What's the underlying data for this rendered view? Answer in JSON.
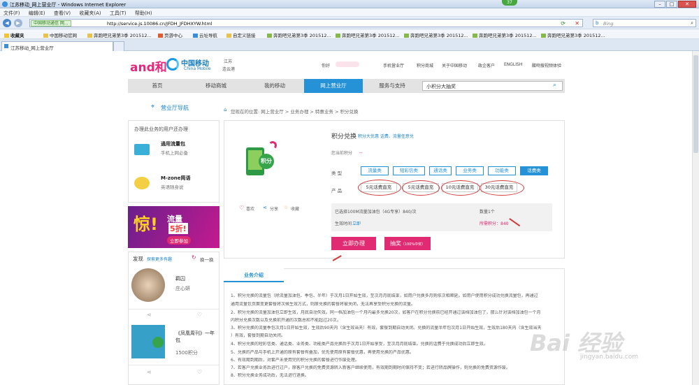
{
  "window": {
    "title": "江苏移动_网上营业厅 - Windows Internet Explorer",
    "badge": "37"
  },
  "menu": [
    "文件(F)",
    "编辑(E)",
    "查看(V)",
    "收藏夹(A)",
    "工具(T)",
    "帮助(H)"
  ],
  "address": {
    "site_label": "中国移动通信 网...",
    "url": "http://service.js.10086.cn/JFDH_JFDHXYW.html",
    "search_placeholder": "Bing"
  },
  "favorites": {
    "label": "收藏夹",
    "items": [
      "中国移动官网",
      "奔跑吧兄弟第3季 201512...",
      "页游中心",
      "云址导航",
      "自定义链接",
      "奔跑吧兄弟第3季 201512...",
      "奔跑吧兄弟第3季 201512...",
      "奔跑吧兄弟第3季 201512...",
      "奔跑吧兄弟第3季 201512...",
      "奔跑吧兄弟第3季 201512..."
    ]
  },
  "tab": {
    "label": "江苏移动_网上营业厅"
  },
  "header": {
    "logo_and": "and和",
    "logo_cm": "中国移动",
    "logo_cm_en": "China Mobile",
    "province": "江苏",
    "city": "连云港",
    "greeting": "你好",
    "links": [
      "手机营业厅",
      "积分商城",
      "关于中国移动",
      "政企客户",
      "ENGLISH",
      "酸吻搜视频体验"
    ]
  },
  "nav": {
    "items": [
      "首页",
      "移动商城",
      "我的移动",
      "网上营业厅",
      "服务与支持"
    ],
    "active": 3,
    "search_value": "小积分大抽奖"
  },
  "sidebar": {
    "title": "营业厅导航",
    "section_title": "办理此业务的用户还办理",
    "products": [
      {
        "name": "通用流量包",
        "desc": "手机上网必备"
      },
      {
        "name": "M-zone简语",
        "desc": "英语随身说"
      }
    ],
    "banner": {
      "big": "惊!",
      "t1": "流量",
      "t2": "5折!",
      "t3": "立即参加"
    },
    "discover": {
      "label": "发现",
      "link": "探索更多有趣",
      "refresh": "换一换"
    },
    "cards": [
      {
        "title": "羁囚",
        "author": "庄心妍"
      },
      {
        "title": "《凤凰周刊》一年包",
        "price": "1500积分"
      }
    ]
  },
  "breadcrumb": "您现在的位置:  网上营业厅  >  业务办理  >  特惠业务  >  积分兑换",
  "product": {
    "icon_text": "积分",
    "title": "积分兑换",
    "subtitle": "积分大优惠 话费、流量任意兑",
    "points_label": "您当前积分",
    "points_value": "--",
    "like": "喜欢",
    "share": "分享",
    "fav": "收藏",
    "type_label": "类    型",
    "types": [
      "流量类",
      "短彩信类",
      "通话类",
      "业务类",
      "功能类",
      "话费类"
    ],
    "types_active": 5,
    "product_label": "产    品",
    "products": [
      "5元话费直充",
      "5元话费直充",
      "10元话费直充",
      "30元话费直充"
    ],
    "selected_text": "已选择100M流量加油包（4G专享）840/次",
    "qty_label": "数量1个",
    "effective_label": "生效时间",
    "effective_value": "立即",
    "need_label": "所需积分：840",
    "btn_buy": "立即办理",
    "btn_lottery": "抽奖",
    "btn_lottery_note": "（100%中奖）"
  },
  "biz": {
    "tab": "业务介绍",
    "lines": [
      "1、积分兑换的流量包（除流量加油包、季包、半年）于次月1日开始生效，至次月月底结束，如用户兑换多月则依次相顺延。如用户使用积分成功兑换流量包，再通过",
      "通用流量包页面变更套餐将次候生效方式，则原兑换的套餐将被关闭，无法再享受积分兑换的流量。",
      "2、积分兑换的流量加油包立即生效，月底自动失效。同一档加油包一个月内最多兑换20次，如客户在积分兑换前已经开通过该档加油包了，那么针对该档加油包一个月",
      "内积分兑换次数以及兑换前开通的次数总和不能超过20次。",
      "3、积分兑换的流量季包次月1日开始生效，生效后90天内（含生效当天）有效，套餐到期自动关闭。兑换的流量半年包次月1日开始生效，生效后180天内（含生效当天",
      "）有效，套餐到期自动关闭。",
      "4、积分兑换的短彩信类、通话类、业务类、功能类产品兑换后于次月1日开始享受，至次月月底结束。兑换的话费于兑换成功后立即生效。",
      "5、兑换的产品与手机上开通的原有套餐有叠加，优先使用原有套餐优惠，再使用兑换的产品优惠。",
      "6、有效期到期后，对套产未使用完的积分兑换的套餐进行作废处理。",
      "7、若客户兑换业务后进行过户，原客户兑换的免费资源转入新客户继续使用，有效期到期时间保持不变；若进行转品牌操作，则兑换的免费资源作废。",
      "8、积分兑换业务成功后，无法进行退换。"
    ]
  },
  "watermark": {
    "big": "Bai 经验",
    "small": "jingyan.baidu.com"
  }
}
